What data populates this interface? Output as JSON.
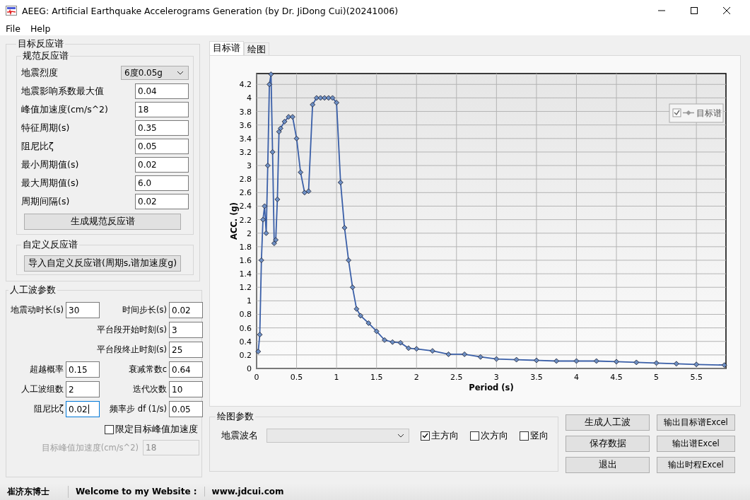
{
  "window": {
    "title": "AEEG: Artificial Earthquake Accelerograms Generation (by Dr. JiDong Cui)(20241006)"
  },
  "menu": [
    "File",
    "Help"
  ],
  "target_spectrum": {
    "title": "目标反应谱",
    "code_spectrum": {
      "title": "规范反应谱",
      "fields": [
        {
          "label": "地震烈度",
          "kind": "select",
          "value": "6度0.05g"
        },
        {
          "label": "地震影响系数最大值",
          "kind": "input",
          "value": "0.04"
        },
        {
          "label": "峰值加速度(cm/s^2)",
          "kind": "input",
          "value": "18"
        },
        {
          "label": "特征周期(s)",
          "kind": "input",
          "value": "0.35"
        },
        {
          "label": "阻尼比ζ",
          "kind": "input",
          "value": "0.05"
        },
        {
          "label": "最小周期值(s)",
          "kind": "input",
          "value": "0.02"
        },
        {
          "label": "最大周期值(s)",
          "kind": "input",
          "value": "6.0"
        },
        {
          "label": "周期间隔(s)",
          "kind": "input",
          "value": "0.02"
        }
      ],
      "button": "生成规范反应谱"
    },
    "custom_spectrum": {
      "title": "自定义反应谱",
      "button": "导入自定义反应谱(周期s,谱加速度g)"
    }
  },
  "wave_params": {
    "title": "人工波参数",
    "rows": [
      {
        "left": {
          "label": "地震动时长(s)",
          "value": "30",
          "focused": false
        },
        "right": {
          "label": "时间步长(s)",
          "value": "0.02"
        }
      },
      {
        "right": {
          "label": "平台段开始时刻(s)",
          "value": "3"
        }
      },
      {
        "right": {
          "label": "平台段终止时刻(s)",
          "value": "25"
        }
      },
      {
        "left": {
          "label": "超越概率",
          "value": "0.15",
          "focused": false
        },
        "right": {
          "label": "衰减常数c",
          "value": "0.64"
        }
      },
      {
        "left": {
          "label": "人工波组数",
          "value": "2",
          "focused": false
        },
        "right": {
          "label": "迭代次数",
          "value": "10"
        }
      },
      {
        "left": {
          "label": "阻尼比ζ",
          "value": "0.02",
          "focused": true
        },
        "right": {
          "label": "频率步 df (1/s)",
          "value": "0.05"
        }
      }
    ],
    "limit_pga": {
      "label": "限定目标峰值加速度",
      "checked": false
    },
    "target_pga": {
      "label": "目标峰值加速度(cm/s^2)",
      "value": "18",
      "disabled": true
    }
  },
  "tabs": [
    {
      "label": "目标谱",
      "selected": true
    },
    {
      "label": "绘图",
      "selected": false
    }
  ],
  "chart": {
    "legend_checked": true,
    "chart_data": {
      "type": "line",
      "xlabel": "Period (s)",
      "ylabel": "ACC. (g)",
      "x": [
        0.02,
        0.04,
        0.06,
        0.08,
        0.1,
        0.12,
        0.14,
        0.16,
        0.18,
        0.2,
        0.22,
        0.24,
        0.26,
        0.28,
        0.3,
        0.35,
        0.4,
        0.45,
        0.5,
        0.55,
        0.6,
        0.65,
        0.7,
        0.75,
        0.8,
        0.85,
        0.9,
        0.95,
        1.0,
        1.05,
        1.1,
        1.15,
        1.2,
        1.25,
        1.3,
        1.4,
        1.5,
        1.6,
        1.7,
        1.8,
        1.9,
        2.0,
        2.2,
        2.4,
        2.6,
        2.8,
        3.0,
        3.25,
        3.5,
        3.75,
        4.0,
        4.25,
        4.5,
        4.75,
        5.0,
        5.25,
        5.5,
        5.85
      ],
      "series": [
        {
          "name": "目标谱",
          "color": "#3a5fa8",
          "values": [
            0.25,
            0.5,
            1.6,
            2.2,
            2.4,
            2.0,
            3.0,
            4.2,
            4.35,
            3.2,
            1.85,
            1.9,
            2.5,
            3.5,
            3.55,
            3.65,
            3.72,
            3.72,
            3.4,
            2.9,
            2.6,
            2.62,
            3.9,
            4.0,
            4.0,
            4.0,
            4.0,
            4.0,
            3.93,
            2.75,
            2.08,
            1.6,
            1.2,
            0.88,
            0.78,
            0.67,
            0.55,
            0.42,
            0.39,
            0.38,
            0.3,
            0.29,
            0.26,
            0.21,
            0.21,
            0.17,
            0.14,
            0.13,
            0.12,
            0.11,
            0.11,
            0.11,
            0.1,
            0.09,
            0.08,
            0.07,
            0.06,
            0.05
          ]
        }
      ],
      "grid": true,
      "marker": "diamond",
      "xlim": [
        0,
        5.87
      ],
      "ylim": [
        0,
        4.36
      ],
      "xticks": [
        0,
        0.5,
        1,
        1.5,
        2,
        2.5,
        3,
        3.5,
        4,
        4.5,
        5,
        5.5
      ],
      "yticks": [
        0,
        0.2,
        0.4,
        0.6,
        0.8,
        1,
        1.2,
        1.4,
        1.6,
        1.8,
        2,
        2.2,
        2.4,
        2.6,
        2.8,
        3,
        3.2,
        3.4,
        3.6,
        3.8,
        4,
        4.2
      ]
    }
  },
  "plot_params": {
    "title": "绘图参数",
    "wave_name_label": "地震波名",
    "directions": [
      {
        "label": "主方向",
        "checked": true
      },
      {
        "label": "次方向",
        "checked": false
      },
      {
        "label": "竖向",
        "checked": false
      }
    ]
  },
  "buttons": [
    "生成人工波",
    "输出目标谱Excel",
    "保存数据",
    "输出谱Excel",
    "退出",
    "输出时程Excel"
  ],
  "status_bar": [
    "崔济东博士",
    "Welcome to my Website :",
    "www.jdcui.com"
  ]
}
